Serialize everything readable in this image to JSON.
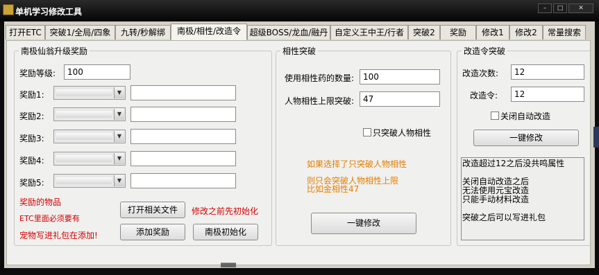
{
  "window": {
    "title": "单机学习修改工具",
    "minimize_label": "–",
    "maximize_label": "□",
    "close_label": "✕",
    "icon": "app-icon"
  },
  "tabs": [
    {
      "label": "打开ETC"
    },
    {
      "label": "突破1/全局/四象"
    },
    {
      "label": "九转/秒解绑"
    },
    {
      "label": "南极/相性/改造令"
    },
    {
      "label": "超级BOSS/龙血/融丹"
    },
    {
      "label": "自定义王中王/行者"
    },
    {
      "label": "突破2"
    },
    {
      "label": "奖励"
    },
    {
      "label": "修改1"
    },
    {
      "label": "修改2"
    },
    {
      "label": "常量搜索"
    }
  ],
  "active_tab": "南极/相性/改造令",
  "nanji": {
    "legend": "南极仙翁升级奖励",
    "level_label": "奖励等级:",
    "level_value": "100",
    "rewards": [
      {
        "label": "奖励1:",
        "value": ""
      },
      {
        "label": "奖励2:",
        "value": ""
      },
      {
        "label": "奖励3:",
        "value": ""
      },
      {
        "label": "奖励4:",
        "value": ""
      },
      {
        "label": "奖励5:",
        "value": ""
      }
    ],
    "notes": [
      "奖励的物品",
      "ETC里面必须要有",
      "宠物写进礼包在添加!"
    ],
    "open_file_button": "打开相关文件",
    "init_hint": "修改之前先初始化",
    "add_reward_button": "添加奖励",
    "init_button": "南极初始化"
  },
  "xiangxing": {
    "legend": "相性突破",
    "potion_label": "使用相性药的数量:",
    "potion_value": "100",
    "limit_label": "人物相性上限突破:",
    "limit_value": "47",
    "only_checkbox_label": "只突破人物相性",
    "hint_line1": "如果选择了只突破人物相性",
    "hint_line2": "则只会突破人物相性上限",
    "hint_line3": "比如金相性47",
    "apply_button": "一键修改"
  },
  "gaizao": {
    "legend": "改造令突破",
    "times_label": "改造次数:",
    "times_value": "12",
    "token_label": "改造令:",
    "token_value": "12",
    "auto_checkbox_label": "关闭自动改造",
    "apply_button": "一键修改",
    "memo_lines": [
      "改造超过12之后没共鸣属性",
      "",
      "关闭自动改造之后",
      "无法使用元宝改造",
      "只能手动材料改造",
      "",
      "突破之后可以写进礼包"
    ]
  },
  "colors": {
    "red": "#d40000",
    "orange": "#e67e00",
    "title_bg": "#0c0c0c"
  }
}
